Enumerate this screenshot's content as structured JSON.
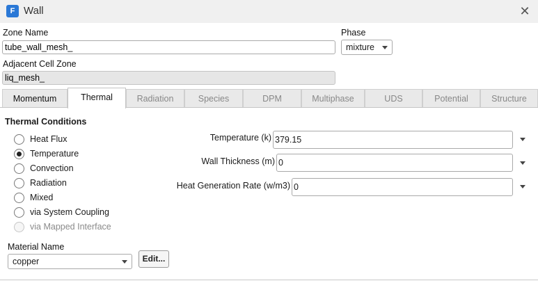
{
  "window": {
    "title": "Wall",
    "app_icon_letter": "F"
  },
  "zone_name": {
    "label": "Zone Name",
    "value": "tube_wall_mesh_"
  },
  "phase": {
    "label": "Phase",
    "value": "mixture"
  },
  "adjacent_cell_zone": {
    "label": "Adjacent Cell Zone",
    "value": "liq_mesh_"
  },
  "tabs": [
    {
      "label": "Momentum",
      "state": "enabled"
    },
    {
      "label": "Thermal",
      "state": "active"
    },
    {
      "label": "Radiation",
      "state": "disabled"
    },
    {
      "label": "Species",
      "state": "disabled"
    },
    {
      "label": "DPM",
      "state": "disabled"
    },
    {
      "label": "Multiphase",
      "state": "disabled"
    },
    {
      "label": "UDS",
      "state": "disabled"
    },
    {
      "label": "Potential",
      "state": "disabled"
    },
    {
      "label": "Structure",
      "state": "disabled"
    }
  ],
  "thermal": {
    "section_title": "Thermal Conditions",
    "conditions": [
      {
        "label": "Heat Flux",
        "selected": false,
        "enabled": true
      },
      {
        "label": "Temperature",
        "selected": true,
        "enabled": true
      },
      {
        "label": "Convection",
        "selected": false,
        "enabled": true
      },
      {
        "label": "Radiation",
        "selected": false,
        "enabled": true
      },
      {
        "label": "Mixed",
        "selected": false,
        "enabled": true
      },
      {
        "label": "via System Coupling",
        "selected": false,
        "enabled": true
      },
      {
        "label": "via Mapped Interface",
        "selected": false,
        "enabled": false
      }
    ],
    "temperature": {
      "label": "Temperature (k)",
      "value": "379.15"
    },
    "wall_thickness": {
      "label": "Wall Thickness (m)",
      "value": "0"
    },
    "heat_generation": {
      "label": "Heat Generation Rate (w/m3)",
      "value": "0"
    },
    "material": {
      "label": "Material Name",
      "value": "copper",
      "edit_label": "Edit..."
    }
  },
  "icons": {
    "close": "close-icon",
    "app": "fluent-app-icon"
  }
}
